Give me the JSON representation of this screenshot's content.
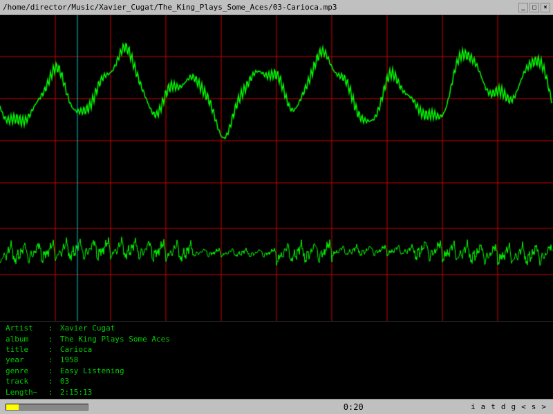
{
  "titlebar": {
    "title": "/home/director/Music/Xavier_Cugat/The_King_Plays_Some_Aces/03-Carioca.mp3",
    "minimize_label": "_",
    "maximize_label": "□",
    "close_label": "×"
  },
  "info": {
    "artist_label": "Artist",
    "artist_value": "Xavier Cugat",
    "album_label": "album",
    "album_value": "The King Plays Some Aces",
    "title_label": "title",
    "title_value": "Carioca",
    "year_label": "year",
    "year_value": "1958",
    "genre_label": "genre",
    "genre_value": "Easy Listening",
    "track_label": "track",
    "track_value": "03",
    "length_label": "Length~",
    "length_value": "2:15:13"
  },
  "statusbar": {
    "time": "0:20",
    "buttons": [
      "i",
      "a",
      "t",
      "d",
      "g",
      "<",
      "s",
      ">"
    ]
  },
  "colors": {
    "grid_red": "#cc0000",
    "waveform_green": "#00ff00",
    "background": "#000000",
    "statusbar_bg": "#c0c0c0",
    "progress_fill": "#ffff00"
  }
}
